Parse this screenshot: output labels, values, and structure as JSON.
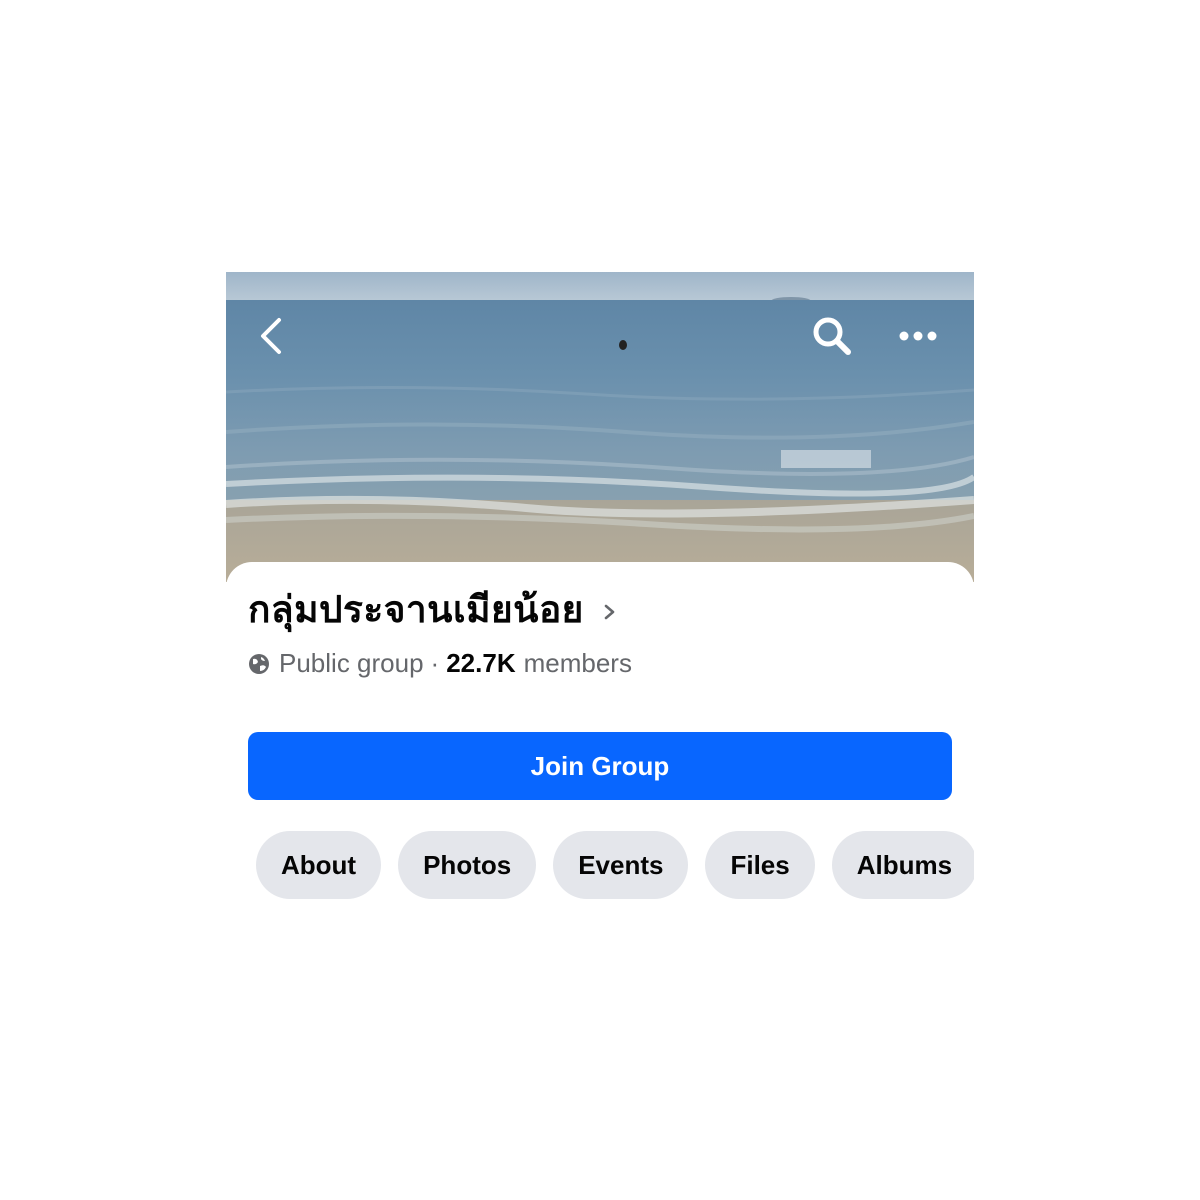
{
  "header": {
    "back_icon": "chevron-left-icon",
    "search_icon": "search-icon",
    "more_icon": "more-horizontal-icon"
  },
  "group": {
    "name": "กลุ่มประจานเมียน้อย",
    "privacy": "Public group",
    "separator": "·",
    "member_count": "22.7K",
    "members_label": "members"
  },
  "actions": {
    "join_label": "Join Group"
  },
  "tabs": [
    {
      "label": "About"
    },
    {
      "label": "Photos"
    },
    {
      "label": "Events"
    },
    {
      "label": "Files"
    },
    {
      "label": "Albums"
    }
  ],
  "colors": {
    "primary": "#0866ff",
    "tab_background": "#e4e6eb",
    "secondary_text": "#65676b"
  }
}
